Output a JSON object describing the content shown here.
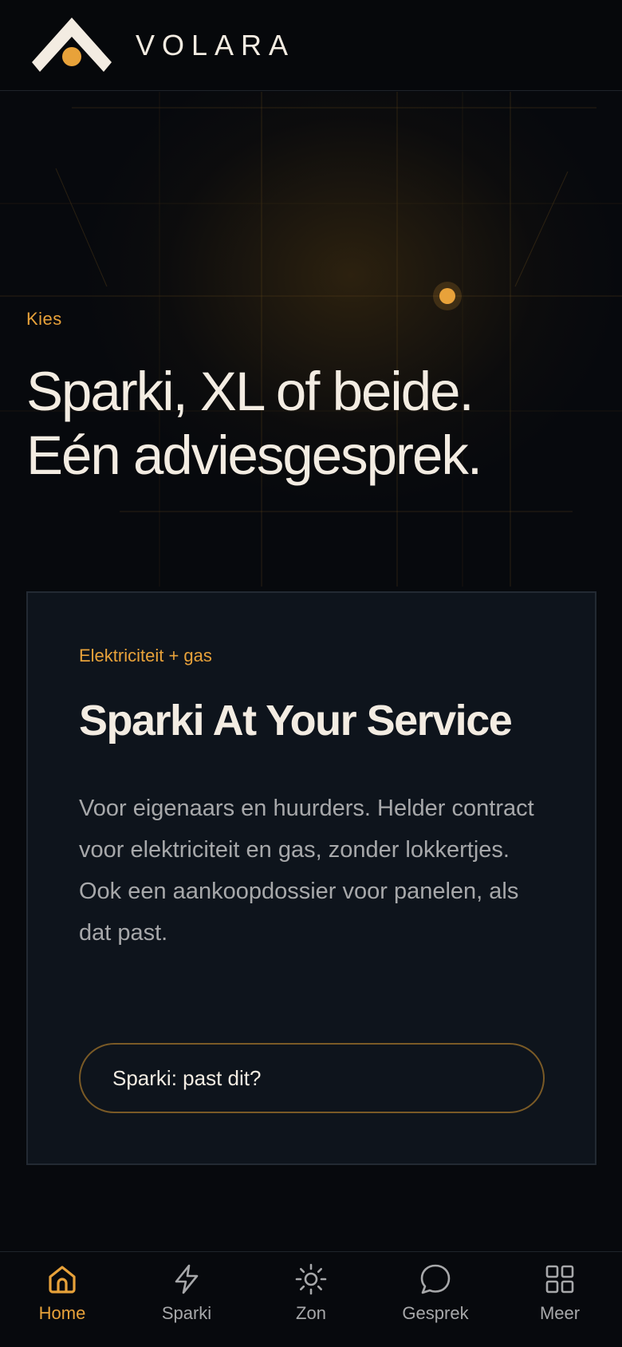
{
  "header": {
    "brand": "VOLARA"
  },
  "hero": {
    "eyebrow": "Kies",
    "title_line1": "Sparki, XL of beide.",
    "title_line2": "Eén adviesgesprek."
  },
  "card": {
    "eyebrow": "Elektriciteit + gas",
    "title": "Sparki At Your Service",
    "text": "Voor eigenaars en huurders. Helder contract voor elektriciteit en gas, zonder lokkertjes. Ook een aankoopdossier voor panelen, als dat past.",
    "cta_label": "Sparki: past dit?"
  },
  "bottom_nav": {
    "items": [
      {
        "label": "Home",
        "icon": "home-icon",
        "active": true
      },
      {
        "label": "Sparki",
        "icon": "lightning-icon",
        "active": false
      },
      {
        "label": "Zon",
        "icon": "sun-icon",
        "active": false
      },
      {
        "label": "Gesprek",
        "icon": "chat-bubble-icon",
        "active": false
      },
      {
        "label": "Meer",
        "icon": "grid-icon",
        "active": false
      }
    ]
  },
  "colors": {
    "accent": "#e8a23a",
    "background": "#07090d",
    "card": "#0e141c",
    "text": "#f3ece2",
    "muted": "#a7a8aa"
  }
}
